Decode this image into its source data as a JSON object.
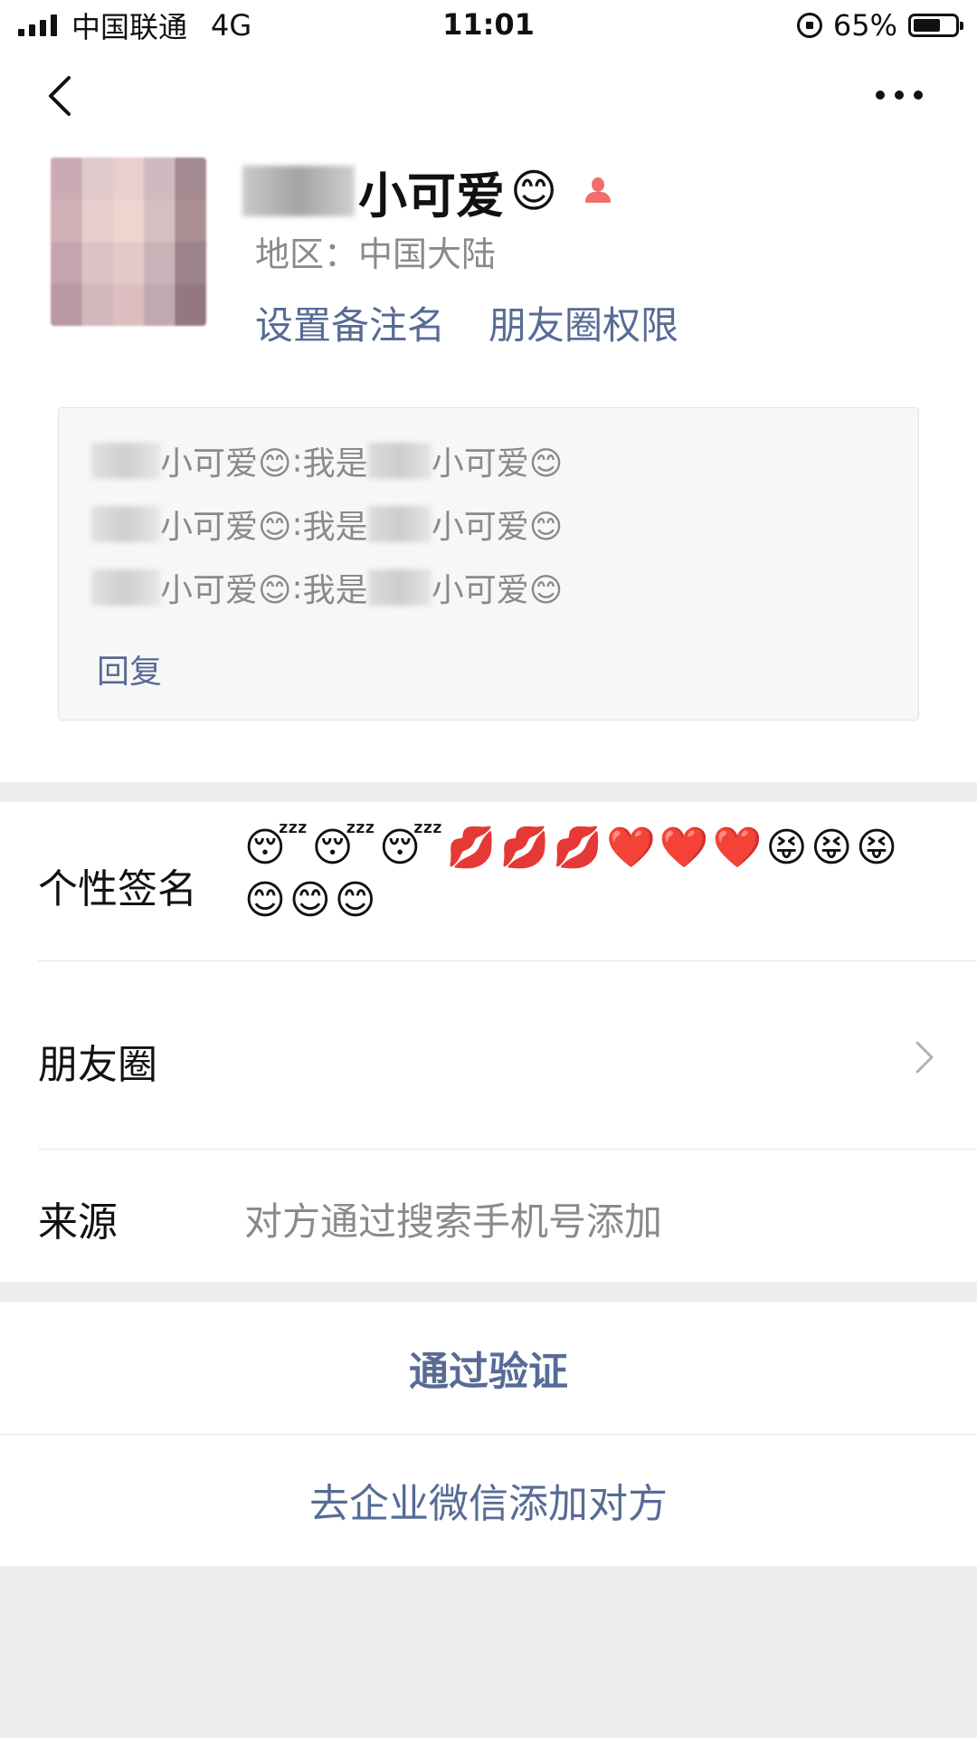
{
  "status_bar": {
    "carrier": "中国联通",
    "network": "4G",
    "time": "11:01",
    "battery_percent_label": "65%",
    "battery_level": 0.65
  },
  "nav": {
    "back_icon": "chevron-left-icon",
    "more_icon": "more-dots-icon"
  },
  "profile": {
    "nickname_visible": "小可爱",
    "nickname_emoji": "😊",
    "gender_icon": "female-icon",
    "region": "地区：中国大陆",
    "set_remark": "设置备注名",
    "moments_permission": "朋友圈权限"
  },
  "greeting": {
    "messages": [
      {
        "sender": "小可爱😊",
        "separator": ": ",
        "prefix": "我是",
        "suffix": "小可爱😊"
      },
      {
        "sender": "小可爱😊",
        "separator": ": ",
        "prefix": "我是",
        "suffix": "小可爱😊"
      },
      {
        "sender": "小可爱😊",
        "separator": ": ",
        "prefix": "我是",
        "suffix": "小可爱😊"
      }
    ],
    "reply": "回复"
  },
  "info": {
    "signature_label": "个性签名",
    "signature_value": "😴😴😴💋💋💋❤️❤️❤️😝😝😝😊😊😊",
    "moments_label": "朋友圈",
    "source_label": "来源",
    "source_value": "对方通过搜索手机号添加"
  },
  "actions": {
    "verify": "通过验证",
    "enterprise": "去企业微信添加对方"
  },
  "colors": {
    "link": "#576b95",
    "secondary_text": "#8a8a8a",
    "background": "#ededed"
  }
}
